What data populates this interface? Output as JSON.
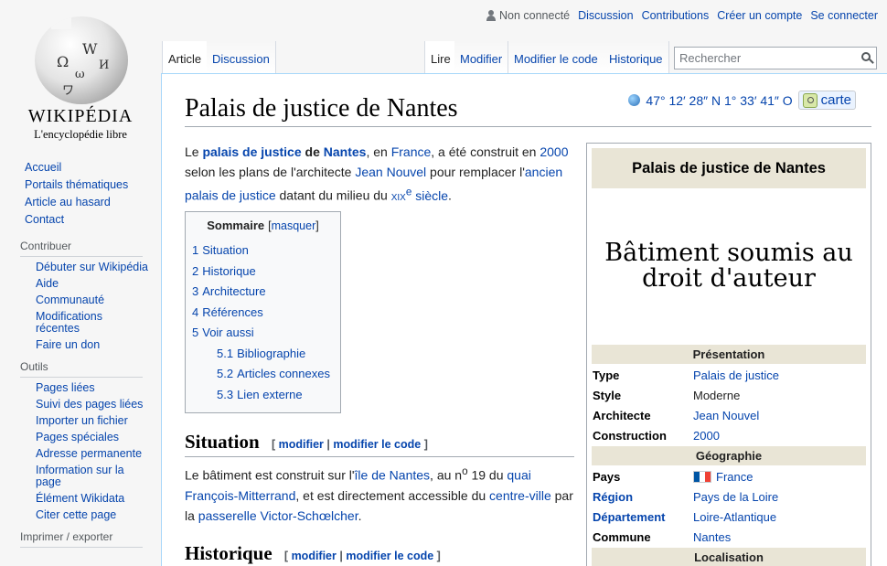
{
  "personal": {
    "not_logged": "Non connecté",
    "discussion": "Discussion",
    "contributions": "Contributions",
    "create_account": "Créer un compte",
    "login": "Se connecter"
  },
  "logo": {
    "wordmark": "WIKIPÉDIA",
    "tagline": "L'encyclopédie libre",
    "glyphs": [
      "Ω",
      "W",
      "И",
      "ω",
      "ワ"
    ]
  },
  "sidebar": {
    "main": [
      "Accueil",
      "Portails thématiques",
      "Article au hasard",
      "Contact"
    ],
    "contribuer_head": "Contribuer",
    "contribuer": [
      "Débuter sur Wikipédia",
      "Aide",
      "Communauté",
      "Modifications récentes",
      "Faire un don"
    ],
    "outils_head": "Outils",
    "outils": [
      "Pages liées",
      "Suivi des pages liées",
      "Importer un fichier",
      "Pages spéciales",
      "Adresse permanente",
      "Information sur la page",
      "Élément Wikidata",
      "Citer cette page"
    ],
    "imprimer_head": "Imprimer / exporter"
  },
  "tabs": {
    "article": "Article",
    "discussion": "Discussion",
    "lire": "Lire",
    "modifier": "Modifier",
    "modifier_code": "Modifier le code",
    "historique": "Historique"
  },
  "search": {
    "placeholder": "Rechercher"
  },
  "page": {
    "title": "Palais de justice de Nantes",
    "coords": "47° 12′ 28″ N 1° 33′ 41″ O",
    "carte": "carte"
  },
  "intro": {
    "t1": "Le ",
    "l1": "palais de justice",
    "t2": " de ",
    "l2": "Nantes",
    "t3": ", en ",
    "l3": "France",
    "t4": ", a été construit en ",
    "l4": "2000",
    "t5": " selon les plans de l'architecte ",
    "l5": "Jean Nouvel",
    "t6": " pour remplacer l'",
    "l6": "ancien palais de justice",
    "t7": " datant du milieu du ",
    "l7a": "xix",
    "l7b": "e",
    "l7c": " siècle",
    "t8": "."
  },
  "toc": {
    "title": "Sommaire",
    "toggle": "masquer",
    "items": [
      {
        "num": "1",
        "label": "Situation"
      },
      {
        "num": "2",
        "label": "Historique"
      },
      {
        "num": "3",
        "label": "Architecture"
      },
      {
        "num": "4",
        "label": "Références"
      },
      {
        "num": "5",
        "label": "Voir aussi"
      }
    ],
    "subitems": [
      {
        "num": "5.1",
        "label": "Bibliographie"
      },
      {
        "num": "5.2",
        "label": "Articles connexes"
      },
      {
        "num": "5.3",
        "label": "Lien externe"
      }
    ]
  },
  "sections": {
    "situation": "Situation",
    "historique": "Historique",
    "edit_open": "[ ",
    "edit_modifier": "modifier",
    "edit_sep": " | ",
    "edit_code": "modifier le code",
    "edit_close": " ]"
  },
  "situation_text": {
    "t1": "Le bâtiment est construit sur l'",
    "l1": "île de Nantes",
    "t2": ", au n",
    "sup": "o",
    "t3": " 19 du ",
    "l2": "quai François-Mitterrand",
    "t4": ", et est directement accessible du ",
    "l3": "centre-ville",
    "t5": " par la ",
    "l4": "passerelle Victor-Schœlcher",
    "t6": "."
  },
  "infobox": {
    "title": "Palais de justice de Nantes",
    "image_text": "Bâtiment soumis au droit d'auteur",
    "section_presentation": "Présentation",
    "presentation": [
      {
        "label": "Type",
        "value": "Palais de justice",
        "linked": true
      },
      {
        "label": "Style",
        "value": "Moderne",
        "linked": false
      },
      {
        "label": "Architecte",
        "value": "Jean Nouvel",
        "linked": true
      },
      {
        "label": "Construction",
        "value": "2000",
        "linked": true
      }
    ],
    "section_geographie": "Géographie",
    "geographie": [
      {
        "label": "Pays",
        "value": "France"
      },
      {
        "label": "Région",
        "value": "Pays de la Loire"
      },
      {
        "label": "Département",
        "value": "Loire-Atlantique"
      },
      {
        "label": "Commune",
        "value": "Nantes"
      }
    ],
    "section_localisation": "Localisation"
  }
}
